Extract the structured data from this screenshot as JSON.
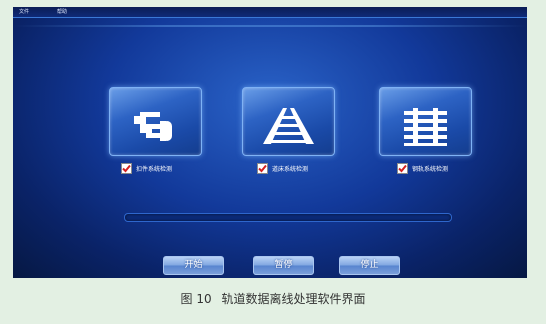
{
  "menu": {
    "file": "文件",
    "help": "帮助"
  },
  "modules": [
    {
      "icon": "fastener-icon",
      "label": "扣件系统检测",
      "checked": true
    },
    {
      "icon": "track-bed-icon",
      "label": "道床系统检测",
      "checked": true
    },
    {
      "icon": "rail-icon",
      "label": "钢轨系统检测",
      "checked": true
    }
  ],
  "progress": {
    "value_percent": 0
  },
  "buttons": {
    "start": "开始",
    "pause": "暂停",
    "stop": "停止"
  },
  "caption": {
    "figure": "图 10",
    "title": "轨道数据离线处理软件界面"
  },
  "colors": {
    "background": "#e3f0e3",
    "screen_blue": "#12399a",
    "check_red": "#d42020",
    "button_blue": "#7fa6e0"
  }
}
